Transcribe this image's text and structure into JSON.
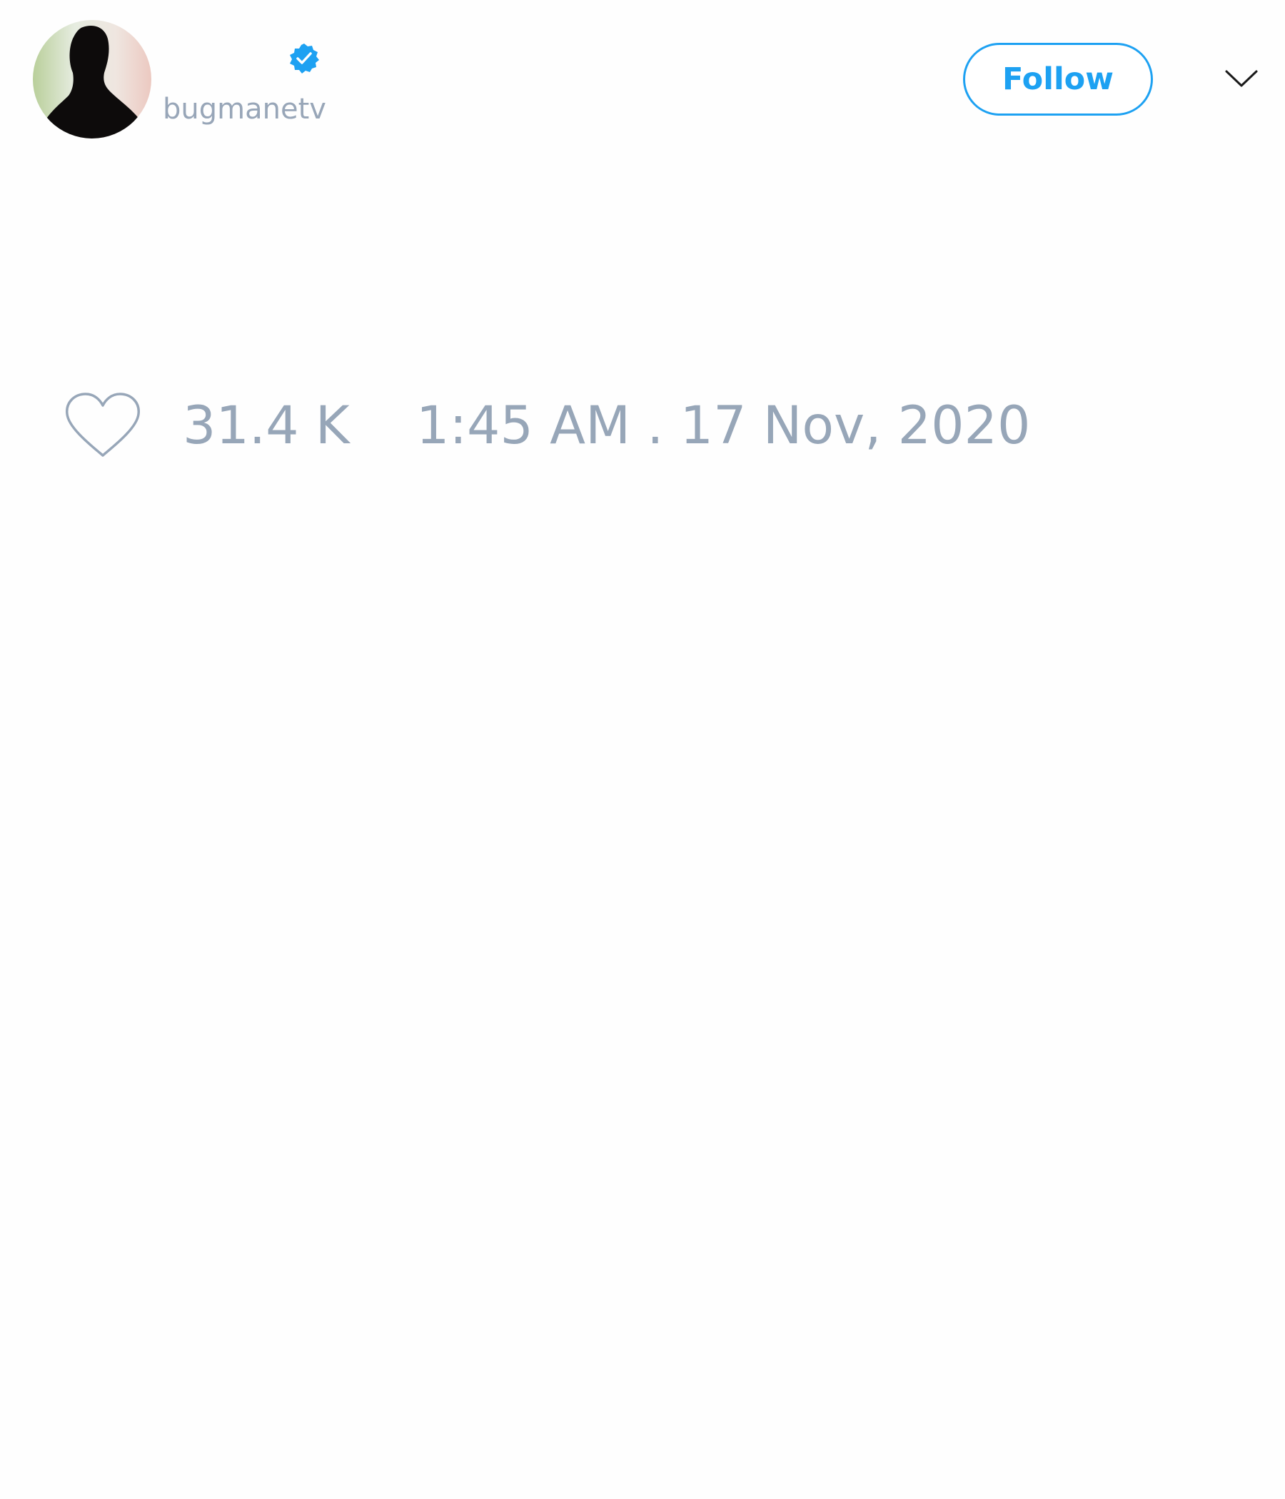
{
  "tweet": {
    "author": {
      "display_name": "",
      "handle": "bugmanetv",
      "verified": true,
      "avatar_icon": "profile-silhouette-icon"
    },
    "follow_label": "Follow",
    "more_icon": "chevron-down-icon",
    "like_icon": "heart-outline-icon",
    "like_count": "31.4 K",
    "timestamp": "1:45 AM . 17 Nov, 2020"
  },
  "colors": {
    "accent": "#1da1f2",
    "muted_text": "#97a6b8",
    "background": "#ffffff"
  }
}
